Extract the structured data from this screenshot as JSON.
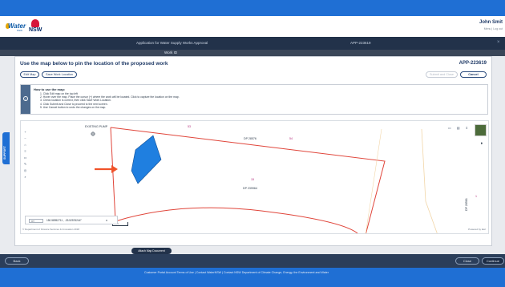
{
  "header": {
    "water_logo_text": "Water",
    "water_logo_sub": "NSW",
    "nsw_logo_text": "NSW",
    "user_name": "John Smit",
    "user_sub": "Menu | Log out"
  },
  "titlebar": {
    "app_title": "Application for Water Supply Works Approval",
    "app_id": "APP-223619",
    "work_id_label": "Work ID"
  },
  "dialog": {
    "title": "Use the map below to pin the location of the proposed work",
    "app_id": "APP-223619",
    "edit_map_label": "Edit Map",
    "save_work_location_label": "Save Work Location",
    "submit_close_label": "Submit and Close",
    "cancel_label": "Cancel"
  },
  "howto": {
    "title": "How to use the map:",
    "steps": [
      "1. Click Edit map on the top left",
      "2. Hover over the map. Place the cursor (+) where the work will be located. Click to capture the location on the map.",
      "3. Check location is correct, then click Save Work Location.",
      "4. Click Submit and Close to proceed to the next screen.",
      "5. Use Cancel button to undo the changes on the map."
    ]
  },
  "map": {
    "existing_pump_label": "EXISTING PUMP",
    "lot_top_label": "53",
    "dp_top_label": "DP 28576",
    "lot_top_right_label": "54",
    "lot_center_label": "15",
    "dp_center_label": "DP 239964",
    "dp_right_label": "DP 28581",
    "lot_right_label": "1",
    "scale_label": "5 m",
    "coords_select": "XY",
    "coords_value": "150.58952711 , -33.52576244°",
    "coords_clear": "x",
    "attribution": "© Department of Finance Services & Innovation 2018",
    "powered_by": "Powered by Esri",
    "colors": {
      "parcel_line": "#e0453a",
      "polygon_fill": "#1f7fe0",
      "arrow": "#f0532a"
    }
  },
  "support_label": "SUPPORT",
  "bottom": {
    "attach_map_label": "Attach Map Document",
    "back_label": "Back",
    "close_label": "Close",
    "continue_label": "Continue"
  },
  "footer": {
    "links": "Customer Portal Account Terms of Use  |  Contact WaterNSW  |  Contact NSW Department of Climate Change, Energy, the Environment and Water"
  }
}
